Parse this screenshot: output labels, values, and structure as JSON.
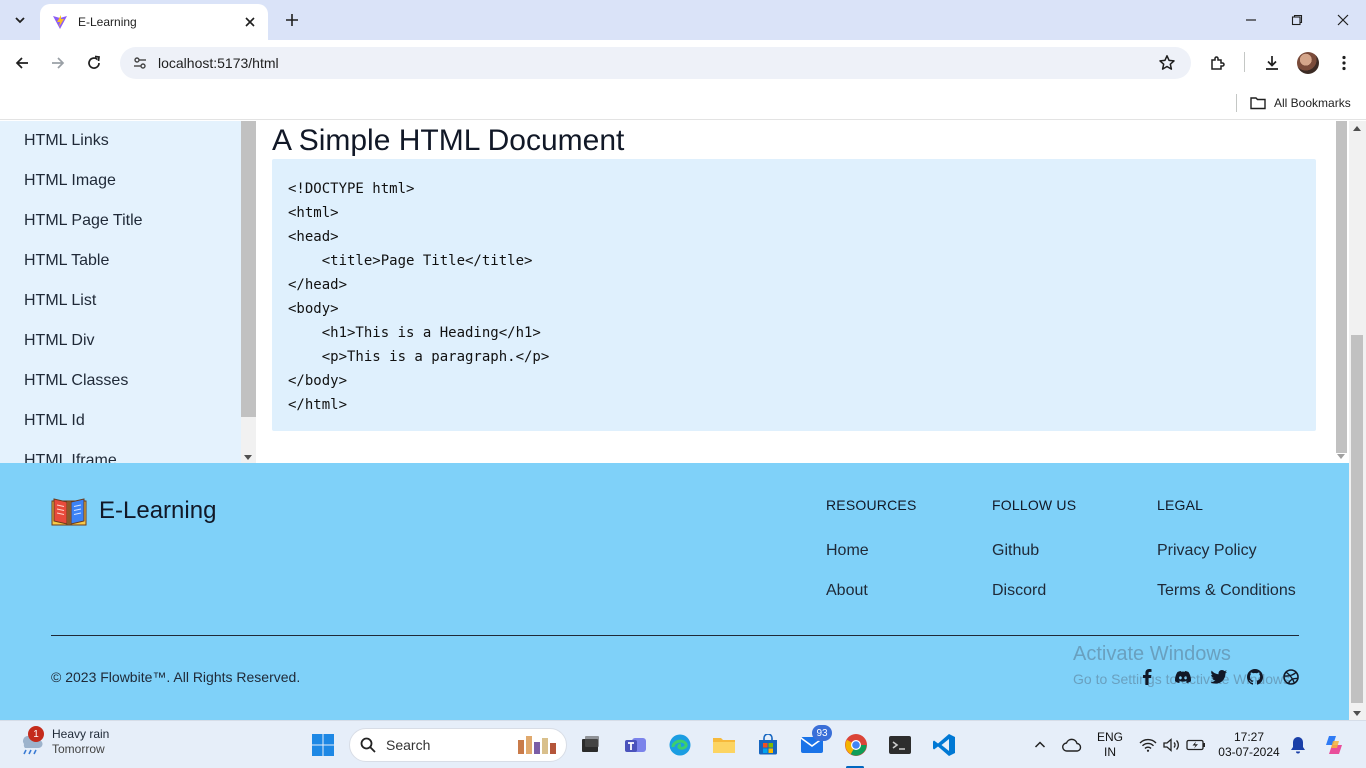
{
  "browser": {
    "tab_title": "E-Learning",
    "url": "localhost:5173/html",
    "all_bookmarks": "All Bookmarks"
  },
  "sidebar": {
    "items": [
      "HTML Links",
      "HTML Image",
      "HTML Page Title",
      "HTML Table",
      "HTML List",
      "HTML Div",
      "HTML Classes",
      "HTML Id",
      "HTML Iframe"
    ]
  },
  "content": {
    "title": "A Simple HTML Document",
    "code_lines": [
      "<!DOCTYPE html>",
      "<html>",
      "<head>",
      "    <title>Page Title</title>",
      "</head>",
      "<body>",
      "    <h1>This is a Heading</h1>",
      "    <p>This is a paragraph.</p>",
      "</body>",
      "</html>"
    ]
  },
  "footer": {
    "brand": "E-Learning",
    "columns": [
      {
        "heading": "RESOURCES",
        "links": [
          "Home",
          "About"
        ]
      },
      {
        "heading": "FOLLOW US",
        "links": [
          "Github",
          "Discord"
        ]
      },
      {
        "heading": "LEGAL",
        "links": [
          "Privacy Policy",
          "Terms & Conditions"
        ]
      }
    ],
    "copyright": "© 2023 Flowbite™. All Rights Reserved.",
    "social_icons": [
      "facebook-icon",
      "discord-icon",
      "twitter-icon",
      "github-icon",
      "dribbble-icon"
    ]
  },
  "watermark": {
    "title": "Activate Windows",
    "subtitle": "Go to Settings to activate Windows."
  },
  "taskbar": {
    "weather_title": "Heavy rain",
    "weather_sub": "Tomorrow",
    "weather_badge": "1",
    "search_placeholder": "Search",
    "mail_badge": "93",
    "lang_line1": "ENG",
    "lang_line2": "IN",
    "time": "17:27",
    "date": "03-07-2024"
  },
  "colors": {
    "footer_bg": "#7fd1f9",
    "sidebar_bg": "#e4f2fd",
    "code_bg": "#dff0fd"
  }
}
